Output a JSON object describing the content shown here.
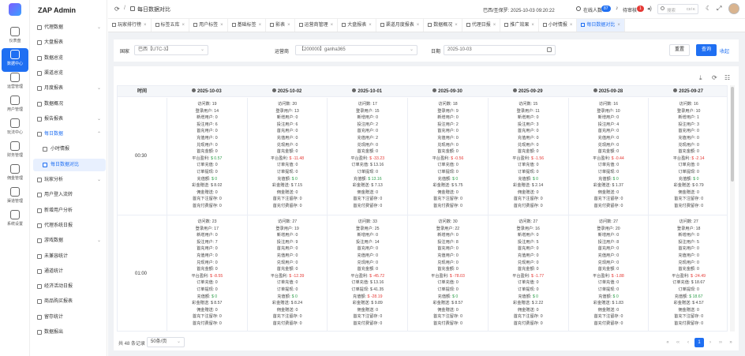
{
  "app": {
    "title": "ZAP Admin"
  },
  "rail": [
    {
      "label": "仪表盘",
      "icon": "dashboard-icon"
    },
    {
      "label": "数据中心",
      "icon": "data-center-icon",
      "active": true
    },
    {
      "label": "运营管理",
      "icon": "operations-icon"
    },
    {
      "label": "用户管理",
      "icon": "users-icon"
    },
    {
      "label": "玩法中心",
      "icon": "play-center-icon"
    },
    {
      "label": "财务管理",
      "icon": "finance-icon"
    },
    {
      "label": "佣金管理",
      "icon": "commission-icon"
    },
    {
      "label": "渠道管理",
      "icon": "channel-icon"
    },
    {
      "label": "系统设置",
      "icon": "settings-icon"
    }
  ],
  "sidebar": [
    {
      "label": "代理数据",
      "level": 0,
      "chev": "⌄"
    },
    {
      "label": "大盘报表",
      "level": 0
    },
    {
      "label": "数据总览",
      "level": 0
    },
    {
      "label": "渠道总览",
      "level": 0
    },
    {
      "label": "月度报表",
      "level": 0,
      "chev": "⌄"
    },
    {
      "label": "数据概况",
      "level": 0
    },
    {
      "label": "报告报表",
      "level": 0,
      "chev": "⌄"
    },
    {
      "label": "每日数据",
      "level": 0,
      "chev": "⌃",
      "open": true
    },
    {
      "label": "小时情报",
      "level": 1
    },
    {
      "label": "每日数据对比",
      "level": 1,
      "active": true
    },
    {
      "label": "玩家分析",
      "level": 0,
      "chev": "⌄"
    },
    {
      "label": "用户登入流转",
      "level": 0
    },
    {
      "label": "新增用户分析",
      "level": 0
    },
    {
      "label": "代理系统日报",
      "level": 0
    },
    {
      "label": "游戏数据",
      "level": 0,
      "chev": "⌄"
    },
    {
      "label": "未兼容统计",
      "level": 0
    },
    {
      "label": "通道统计",
      "level": 0
    },
    {
      "label": "经济活动日报",
      "level": 0
    },
    {
      "label": "商品购买报表",
      "level": 0
    },
    {
      "label": "留存统计",
      "level": 0
    },
    {
      "label": "数据报出",
      "level": 0
    }
  ],
  "topbar": {
    "breadcrumb_sep": "/",
    "page": "每日数据对比",
    "datetime": "巴西/圣保罗: 2025-10-03 09:20:22",
    "online_label": "在线人数",
    "online_count": "87",
    "pending_label": "待审核",
    "pending_count": "1",
    "search_placeholder": "搜索",
    "search_hint": "Ctrl K"
  },
  "tabs": [
    {
      "label": "玩家排行榜"
    },
    {
      "label": "标签五库"
    },
    {
      "label": "用户标签"
    },
    {
      "label": "基础标签"
    },
    {
      "label": "影表"
    },
    {
      "label": "运营商管理"
    },
    {
      "label": "大盘报表"
    },
    {
      "label": "渠道月度报表"
    },
    {
      "label": "数据概况"
    },
    {
      "label": "代理日报"
    },
    {
      "label": "推广效果"
    },
    {
      "label": "小时情报"
    },
    {
      "label": "每日数据对比",
      "active": true
    }
  ],
  "filter": {
    "country_label": "国家",
    "country_value": "巴西【UTC-3】",
    "operator_label": "运营商",
    "operator_value": "【200000】ganha365",
    "date_label": "日期",
    "date_value": "2025-10-03",
    "reset": "重置",
    "query": "查询",
    "collapse": "收起"
  },
  "table": {
    "time_header": "时间",
    "dates": [
      "2025-10-03",
      "2025-10-02",
      "2025-10-01",
      "2025-09-30",
      "2025-09-29",
      "2025-09-28",
      "2025-09-27"
    ],
    "row_labels": [
      "访问数",
      "登录用户",
      "新增用户",
      "投注用户",
      "首充用户",
      "充值用户",
      "兑现用户",
      "首充金额",
      "平台盈利",
      "订单充值",
      "订单提现",
      "充值额",
      "彩金赠送",
      "佣金赠送",
      "首充下注留存",
      "首充付费留存"
    ],
    "rows": [
      {
        "time": "00:30",
        "cells": [
          [
            "19",
            "14",
            "0",
            "6",
            "0",
            "0",
            "0",
            "0",
            "$ 0.57",
            "0",
            "0",
            "$ 0",
            "$ 8.02",
            "0",
            "0",
            "0"
          ],
          [
            "20",
            "13",
            "0",
            "6",
            "0",
            "0",
            "0",
            "0",
            "$ -11.48",
            "0",
            "0",
            "$ 0",
            "$ 7.15",
            "0",
            "0",
            "0"
          ],
          [
            "17",
            "15",
            "0",
            "2",
            "0",
            "2",
            "0",
            "0",
            "$ -33.23",
            "$ 13.16",
            "0",
            "$ 13.16",
            "$ 7.13",
            "0",
            "0",
            "0"
          ],
          [
            "18",
            "9",
            "0",
            "2",
            "0",
            "0",
            "0",
            "0",
            "$ -0.56",
            "0",
            "0",
            "$ 0",
            "$ 5.75",
            "0",
            "0",
            "0"
          ],
          [
            "15",
            "11",
            "0",
            "3",
            "0",
            "0",
            "0",
            "0",
            "$ -1.56",
            "0",
            "0",
            "$ 0",
            "$ 2.14",
            "0",
            "0",
            "0"
          ],
          [
            "16",
            "10",
            "0",
            "4",
            "0",
            "0",
            "0",
            "0",
            "$ -0.44",
            "0",
            "0",
            "$ 0",
            "$ 1.37",
            "0",
            "0",
            "0"
          ],
          [
            "16",
            "10",
            "1",
            "3",
            "0",
            "0",
            "0",
            "0",
            "$ -2.14",
            "0",
            "0",
            "$ 0",
            "$ 0.79",
            "0",
            "0",
            "0"
          ]
        ]
      },
      {
        "time": "01:00",
        "cells": [
          [
            "23",
            "17",
            "0",
            "7",
            "0",
            "0",
            "0",
            "0",
            "$ -8.55",
            "0",
            "0",
            "$ 0",
            "$ 8.57",
            "0",
            "0",
            "0"
          ],
          [
            "27",
            "19",
            "0",
            "9",
            "0",
            "0",
            "0",
            "0",
            "$ -12.39",
            "0",
            "0",
            "$ 0",
            "$ 8.24",
            "0",
            "0",
            "0"
          ],
          [
            "33",
            "25",
            "0",
            "14",
            "0",
            "0",
            "0",
            "0",
            "$ -45.72",
            "$ 13.16",
            "$ 41.35",
            "$ -28.19",
            "$ 9.89",
            "0",
            "0",
            "0"
          ],
          [
            "30",
            "22",
            "0",
            "8",
            "0",
            "0",
            "0",
            "0",
            "$ -78.03",
            "0",
            "0",
            "$ 0",
            "$ 8.57",
            "0",
            "0",
            "0"
          ],
          [
            "27",
            "16",
            "0",
            "5",
            "0",
            "0",
            "0",
            "0",
            "$ -1.77",
            "0",
            "0",
            "$ 0",
            "$ 2.22",
            "0",
            "0",
            "0"
          ],
          [
            "27",
            "20",
            "0",
            "8",
            "0",
            "0",
            "0",
            "0",
            "$ -1.88",
            "0",
            "0",
            "$ 0",
            "$ 1.83",
            "0",
            "0",
            "0"
          ],
          [
            "27",
            "18",
            "0",
            "5",
            "0",
            "0",
            "0",
            "0",
            "$ -24.49",
            "$ 18.67",
            "0",
            "$ 18.67",
            "$ 4.57",
            "0",
            "0",
            "0"
          ]
        ]
      }
    ]
  },
  "pagination": {
    "total": "共 48 条记录",
    "page_size": "50条/页",
    "current": "1"
  },
  "colors": {
    "accent": "#1f6ff2",
    "negative": "#e53935",
    "positive": "#2e9e4a"
  }
}
